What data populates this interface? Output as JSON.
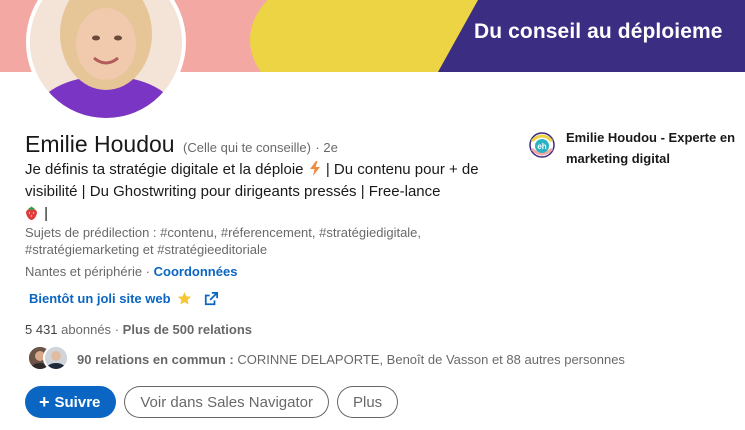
{
  "banner": {
    "tagline": "Du conseil au déploieme",
    "colors": {
      "pink": "#f3a8a4",
      "yellow": "#ecd445",
      "purple": "#3b2d82"
    }
  },
  "profile": {
    "name": "Emilie Houdou",
    "pronoun_note": "(Celle qui te conseille)",
    "degree": "· 2e",
    "headline_part1": "Je définis ta stratégie digitale et la déploie",
    "headline_part2": "| Du contenu pour + de visibilité | Du Ghostwriting pour dirigeants pressés | Free-lance",
    "headline_part3": "|",
    "topics": "Sujets de prédilection : #contenu, #réferencement, #stratégiedigitale, #stratégiemarketing et #stratégieeditoriale",
    "location": "Nantes et périphérie ·",
    "contact_link": "Coordonnées",
    "website_label": "Bientôt un joli site web"
  },
  "stats": {
    "followers": "5 431",
    "followers_label": "abonnés",
    "separator": "·",
    "connections": "Plus de 500 relations"
  },
  "mutual": {
    "count_label": "90 relations en commun :",
    "names": "CORINNE DELAPORTE, Benoît de Vasson et 88 autres personnes"
  },
  "actions": {
    "follow": "Suivre",
    "follow_icon": "plus-icon",
    "sales_navigator": "Voir dans Sales Navigator",
    "more": "Plus"
  },
  "company": {
    "logo_icon": "eh-logo-icon",
    "name": "Emilie Houdou - Experte en marketing digital"
  },
  "colors": {
    "accent": "#0a66c2"
  }
}
